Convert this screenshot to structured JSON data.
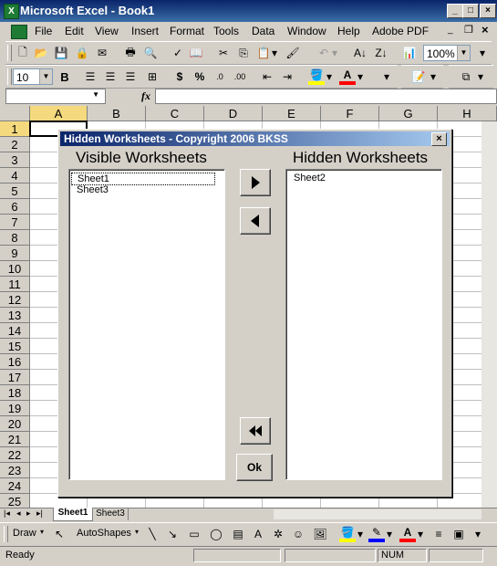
{
  "window": {
    "title": "Microsoft Excel - Book1"
  },
  "menu": [
    "File",
    "Edit",
    "View",
    "Insert",
    "Format",
    "Tools",
    "Data",
    "Window",
    "Help",
    "Adobe PDF"
  ],
  "toolbar": {
    "zoom": "100%",
    "font_size": "10",
    "bold": "B",
    "percent": "%",
    "dollar": "$"
  },
  "formula": {
    "fx": "fx"
  },
  "grid": {
    "columns": [
      "A",
      "B",
      "C",
      "D",
      "E",
      "F",
      "G",
      "H"
    ],
    "rows": [
      "1",
      "2",
      "3",
      "4",
      "5",
      "6",
      "7",
      "8",
      "9",
      "10",
      "11",
      "12",
      "13",
      "14",
      "15",
      "16",
      "17",
      "18",
      "19",
      "20",
      "21",
      "22",
      "23",
      "24",
      "25"
    ]
  },
  "sheet_tabs": [
    "Sheet1",
    "Sheet3"
  ],
  "drawing": {
    "draw": "Draw",
    "autoshapes": "AutoShapes"
  },
  "status": {
    "ready": "Ready",
    "num": "NUM"
  },
  "dialog": {
    "title": "Hidden Worksheets - Copyright 2006 BKSS",
    "visible_heading": "Visible Worksheets",
    "hidden_heading": "Hidden Worksheets",
    "visible_items": [
      "Sheet1",
      "Sheet3"
    ],
    "hidden_items": [
      "Sheet2"
    ],
    "ok_label": "Ok"
  }
}
